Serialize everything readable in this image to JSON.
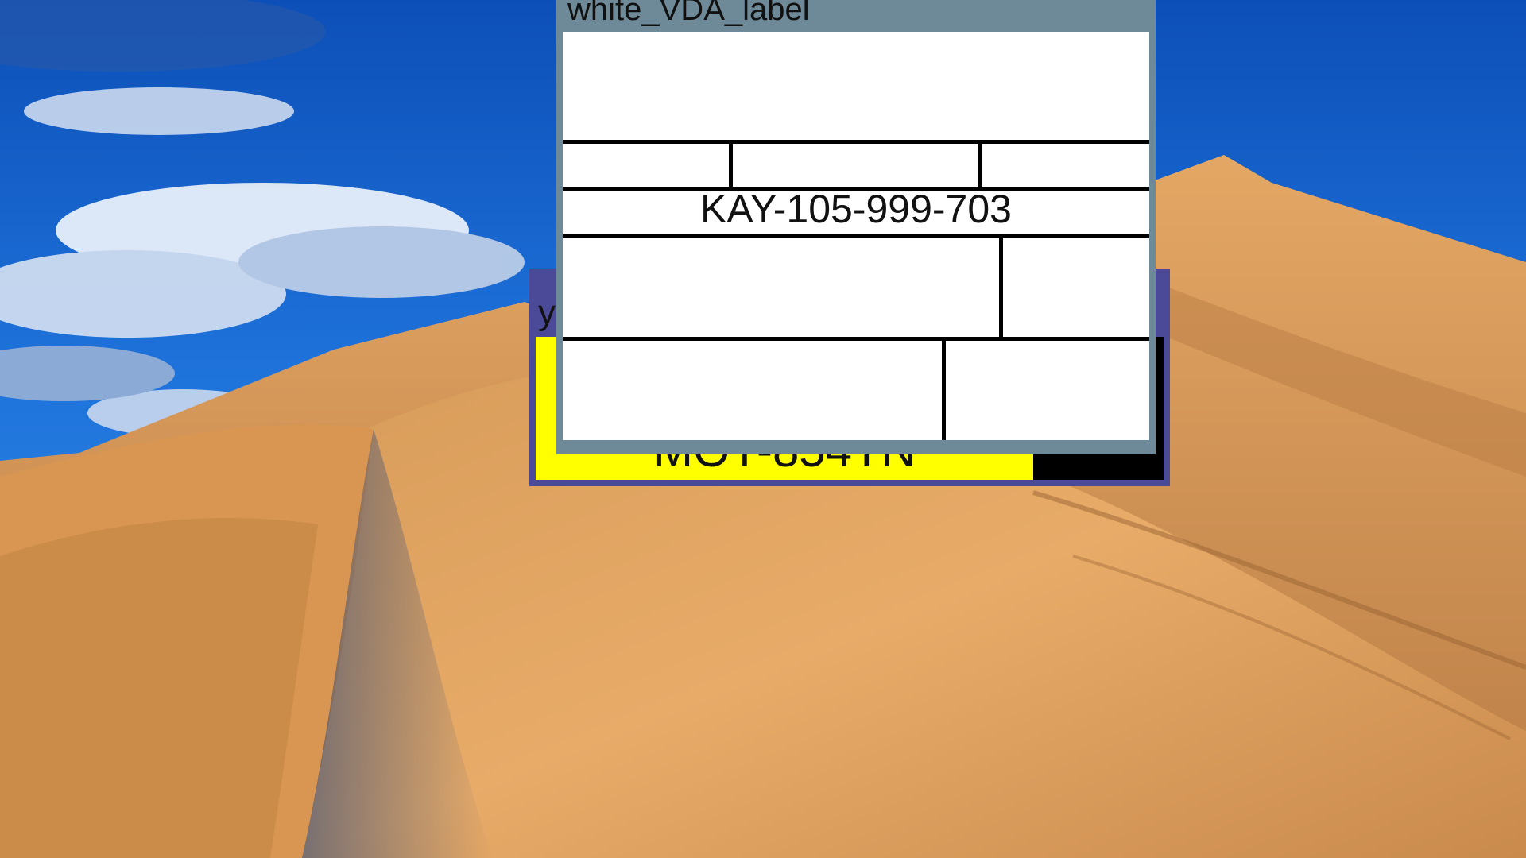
{
  "wallpaper": {
    "sky_color": "#1f6fd6",
    "sand_color": "#e0a45e"
  },
  "windows": {
    "yellow_label": {
      "title": "yellow_label",
      "title_bar_color": "#4a4a98",
      "field_color": "#ffff00",
      "plate_text": "MOT-854TN"
    },
    "white_vda_label": {
      "title": "white_VDA_label",
      "title_bar_color": "#6e8a98",
      "code": "KAY-105-999-703"
    }
  }
}
